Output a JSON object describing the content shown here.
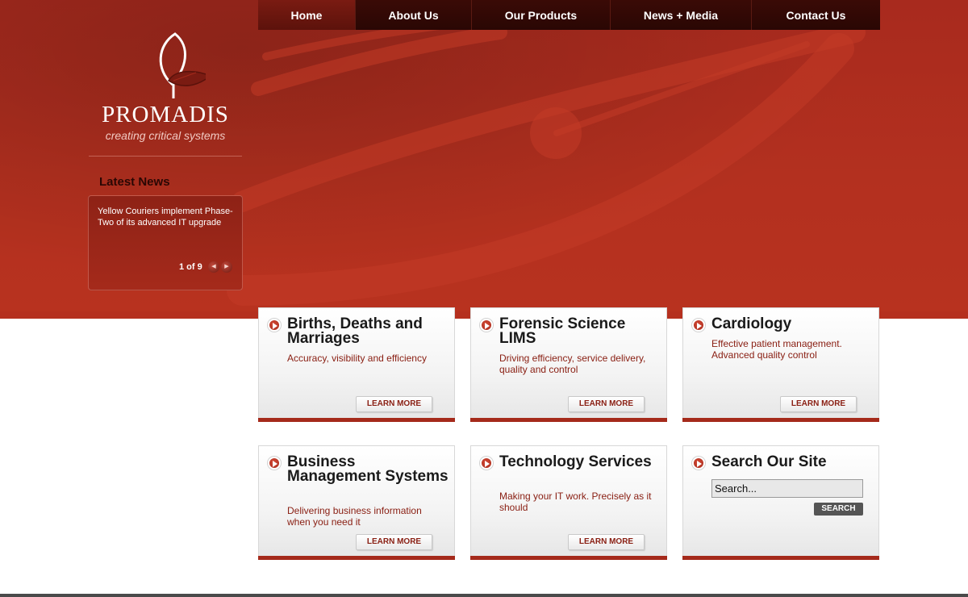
{
  "nav": {
    "items": [
      {
        "label": "Home",
        "active": true
      },
      {
        "label": "About Us"
      },
      {
        "label": "Our Products"
      },
      {
        "label": "News + Media"
      },
      {
        "label": "Contact Us"
      }
    ]
  },
  "logo": {
    "name": "PROMADIS",
    "tagline": "creating critical systems"
  },
  "news": {
    "title": "Latest News",
    "headline": "Yellow Couriers implement Phase-Two of its advanced IT upgrade",
    "pager": "1 of 9"
  },
  "cards": [
    {
      "title": "Births, Deaths and Marriages",
      "desc": "Accuracy, visibility and efficiency",
      "button": "LEARN MORE"
    },
    {
      "title": "Forensic Science LIMS",
      "desc": "Driving efficiency, service delivery, quality and control",
      "button": "LEARN MORE"
    },
    {
      "title": "Cardiology",
      "desc": "Effective patient management. Advanced quality control",
      "button": "LEARN MORE"
    },
    {
      "title": "Business Management Systems",
      "desc": "Delivering business information when you need it",
      "button": "LEARN MORE"
    },
    {
      "title": "Technology Services",
      "desc": "Making your IT work. Precisely as it should",
      "button": "LEARN MORE"
    }
  ],
  "search": {
    "title": "Search Our Site",
    "value": "Search...",
    "button": "SEARCH"
  },
  "colors": {
    "brand_red": "#a52a1b",
    "nav_dark": "#2a0704"
  }
}
